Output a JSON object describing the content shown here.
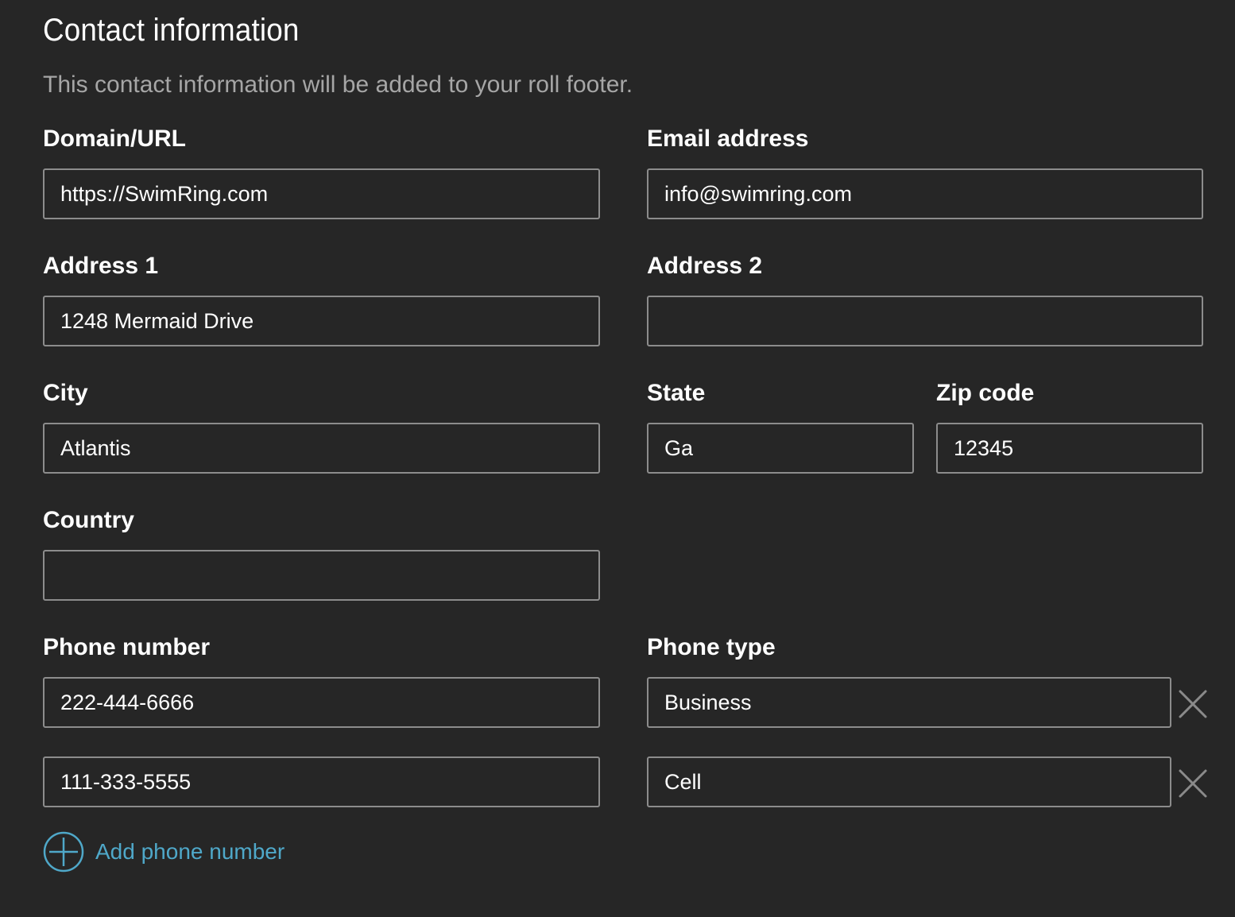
{
  "header": {
    "title": "Contact information",
    "subtitle": "This contact information will be added to your roll footer."
  },
  "form": {
    "domain": {
      "label": "Domain/URL",
      "value": "https://SwimRing.com"
    },
    "email": {
      "label": "Email address",
      "value": "info@swimring.com"
    },
    "address1": {
      "label": "Address 1",
      "value": "1248 Mermaid Drive"
    },
    "address2": {
      "label": "Address 2",
      "value": ""
    },
    "city": {
      "label": "City",
      "value": "Atlantis"
    },
    "state": {
      "label": "State",
      "value": "Ga"
    },
    "zip": {
      "label": "Zip code",
      "value": "12345"
    },
    "country": {
      "label": "Country",
      "value": ""
    },
    "phone_number_label": "Phone number",
    "phone_type_label": "Phone type",
    "phones": [
      {
        "number": "222-444-6666",
        "type": "Business"
      },
      {
        "number": "111-333-5555",
        "type": "Cell"
      }
    ],
    "add_phone_label": "Add phone number"
  },
  "colors": {
    "background": "#262626",
    "field_border": "#8c8c8c",
    "subtitle": "#a6a6a6",
    "accent": "#4fa8c9",
    "remove_icon": "#8a8a8a"
  },
  "icons": {
    "remove": "close-icon",
    "add": "plus-circle-icon"
  }
}
